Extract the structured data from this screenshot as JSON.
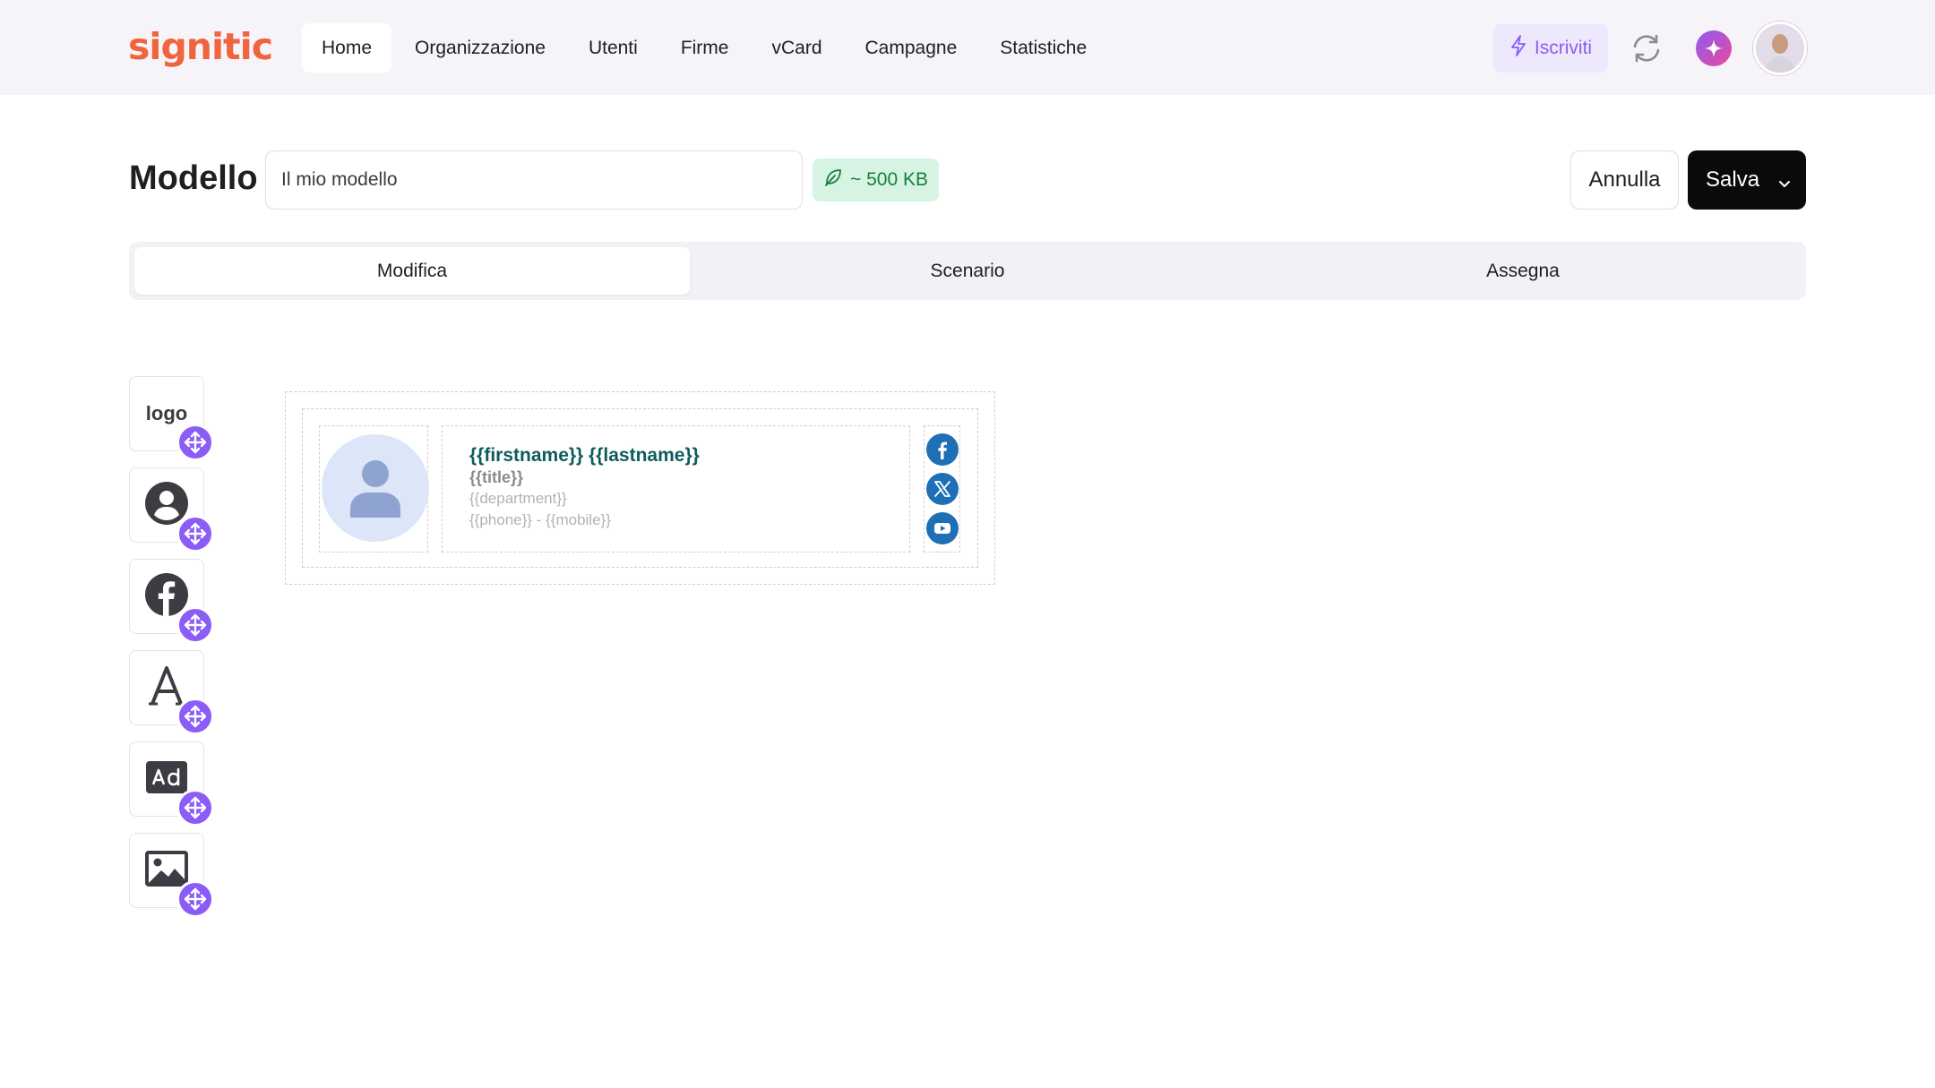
{
  "app": {
    "brand": "signitic",
    "brand_color": "#f0643e",
    "accent_color": "#8b5cf6"
  },
  "nav": {
    "items": [
      {
        "label": "Home",
        "active": true
      },
      {
        "label": "Organizzazione"
      },
      {
        "label": "Utenti"
      },
      {
        "label": "Firme"
      },
      {
        "label": "vCard"
      },
      {
        "label": "Campagne"
      },
      {
        "label": "Statistiche"
      }
    ],
    "subscribe_label": "Iscriviti",
    "icons": [
      "lightning-icon",
      "sync-icon",
      "sparkle-icon",
      "user-avatar"
    ]
  },
  "header": {
    "title": "Modello",
    "name_value": "Il mio modello",
    "size_badge": "~ 500 KB",
    "cancel_label": "Annulla",
    "save_label": "Salva"
  },
  "tabs": [
    {
      "label": "Modifica",
      "active": true
    },
    {
      "label": "Scenario"
    },
    {
      "label": "Assegna"
    }
  ],
  "tools": {
    "logo_label": "logo",
    "items": [
      "logo",
      "person-icon",
      "facebook-icon",
      "text-icon",
      "ad-icon",
      "image-icon"
    ],
    "move_icon": "move-icon"
  },
  "signature": {
    "name": "{{firstname}} {{lastname}}",
    "title": "{{title}}",
    "department": "{{department}}",
    "contact": "{{phone}} - {{mobile}}",
    "social": [
      "facebook-icon",
      "x-icon",
      "youtube-icon"
    ],
    "name_color": "#0f5c5c",
    "social_color": "#1f6fb5"
  }
}
